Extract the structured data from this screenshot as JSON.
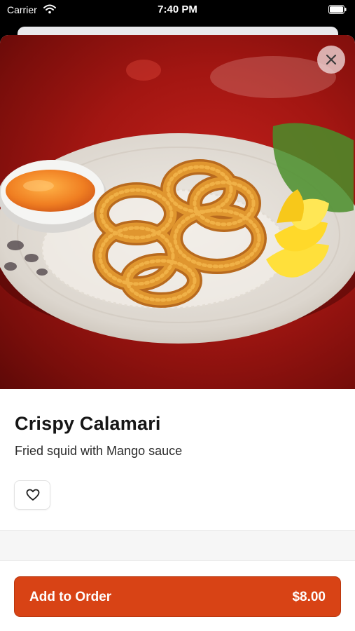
{
  "status_bar": {
    "carrier": "Carrier",
    "time": "7:40 PM"
  },
  "item": {
    "title": "Crispy Calamari",
    "description": "Fried squid with Mango sauce"
  },
  "order_button": {
    "label": "Add to Order",
    "price": "$8.00"
  },
  "icons": {
    "close": "close-icon",
    "favorite": "heart-icon",
    "wifi": "wifi-icon",
    "battery": "battery-icon"
  },
  "colors": {
    "accent": "#d84315",
    "background": "#ffffff"
  }
}
